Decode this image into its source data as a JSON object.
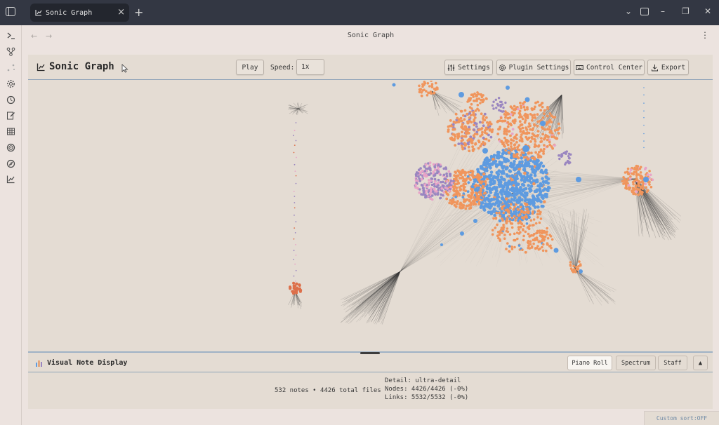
{
  "tab": {
    "title": "Sonic Graph",
    "close": "×",
    "add": "+"
  },
  "window_controls": {
    "chevron": "⌄",
    "minimize": "–",
    "restore": "❐",
    "close": "✕"
  },
  "nav": {
    "back": "←",
    "forward": "→",
    "title": "Sonic Graph",
    "more": "⋮"
  },
  "header": {
    "title": "Sonic Graph",
    "play_label": "Play",
    "speed_label": "Speed:",
    "speed_value": "1x",
    "settings_label": "Settings",
    "plugin_settings_label": "Plugin Settings",
    "control_center_label": "Control Center",
    "export_label": "Export"
  },
  "visual_note_display": {
    "title": "Visual Note Display",
    "modes": [
      "Piano Roll",
      "Spectrum",
      "Staff"
    ],
    "active_mode": "Piano Roll",
    "collapse": "▲"
  },
  "stats": {
    "summary": "532 notes • 4426 total files",
    "detail": "Detail: ultra-detail",
    "nodes": "Nodes: 4426/4426 (-0%)",
    "links": "Links: 5532/5532 (-0%)"
  },
  "status_bar": {
    "custom_sort": "Custom sort:OFF"
  },
  "colors": {
    "node_orange": "#f0955c",
    "node_blue": "#5e9be0",
    "node_purple": "#9a86c0",
    "node_pink": "#e8a3c7",
    "node_red": "#dd6f4a",
    "link": "#3a3a3a"
  },
  "ribbon_icons": [
    "terminal-icon",
    "git-branch-icon",
    "graph-icon",
    "gear-icon",
    "clock-icon",
    "note-edit-icon",
    "table-icon",
    "spiral-icon",
    "compass-icon",
    "sonic-graph-icon"
  ]
}
